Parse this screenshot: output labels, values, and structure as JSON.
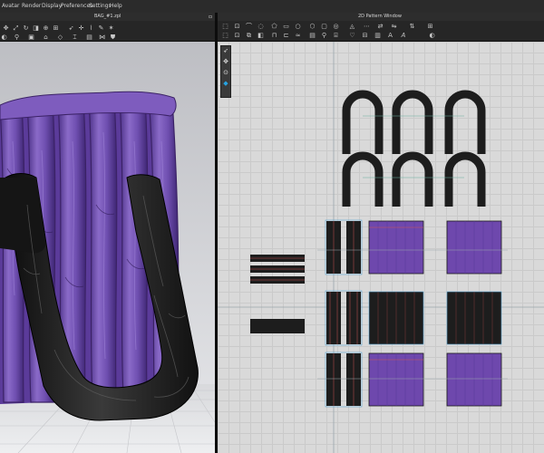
{
  "menu": {
    "items": [
      "Avatar",
      "Render",
      "Display",
      "Preferences",
      "Settings",
      "Help"
    ]
  },
  "viewport3d": {
    "tab_title": "BAG_#1.zpl",
    "toolbar_icons": [
      "move-icon",
      "expand-icon",
      "rotate-icon",
      "fold-icon",
      "pin-icon",
      "scale-icon",
      "select-icon",
      "tack-icon",
      "fold-angle-icon",
      "pen-icon",
      "star-icon",
      "button-icon",
      "zip-icon",
      "shield-icon",
      "fabric-icon"
    ]
  },
  "viewport2d": {
    "title": "2D Pattern Window",
    "toolbar_row1_icons": [
      "transform-icon",
      "edit-point-icon",
      "edit-curve-icon",
      "curve-point-icon",
      "polygon-icon",
      "rectangle-icon",
      "circle-icon",
      "internal-polygon-icon",
      "internal-rectangle-icon",
      "internal-circle-icon",
      "dart-icon",
      "sewing-icon",
      "segment-sewing-icon",
      "free-sewing-icon",
      "text-icon",
      "texture-icon"
    ],
    "toolbar_row2_icons": [
      "select-icon",
      "trace-icon",
      "offset-icon",
      "fold-icon",
      "notch-icon",
      "seam-icon",
      "elastic-icon",
      "tape-icon",
      "pin-icon",
      "fabric-icon",
      "wave-icon",
      "shrink-icon",
      "measure-icon",
      "annotation-icon",
      "graphic-icon",
      "texture-edit-icon"
    ],
    "side_tools": [
      "select-icon",
      "move-icon",
      "zoom-icon",
      "pattern-icon"
    ]
  },
  "colors": {
    "fabric_purple": "#6e48ad",
    "fabric_purple_dark": "#4a2c80",
    "handle_black": "#1a1a1a",
    "ui_dark": "#1e1e1e",
    "accent_blue": "#27a2e0"
  }
}
